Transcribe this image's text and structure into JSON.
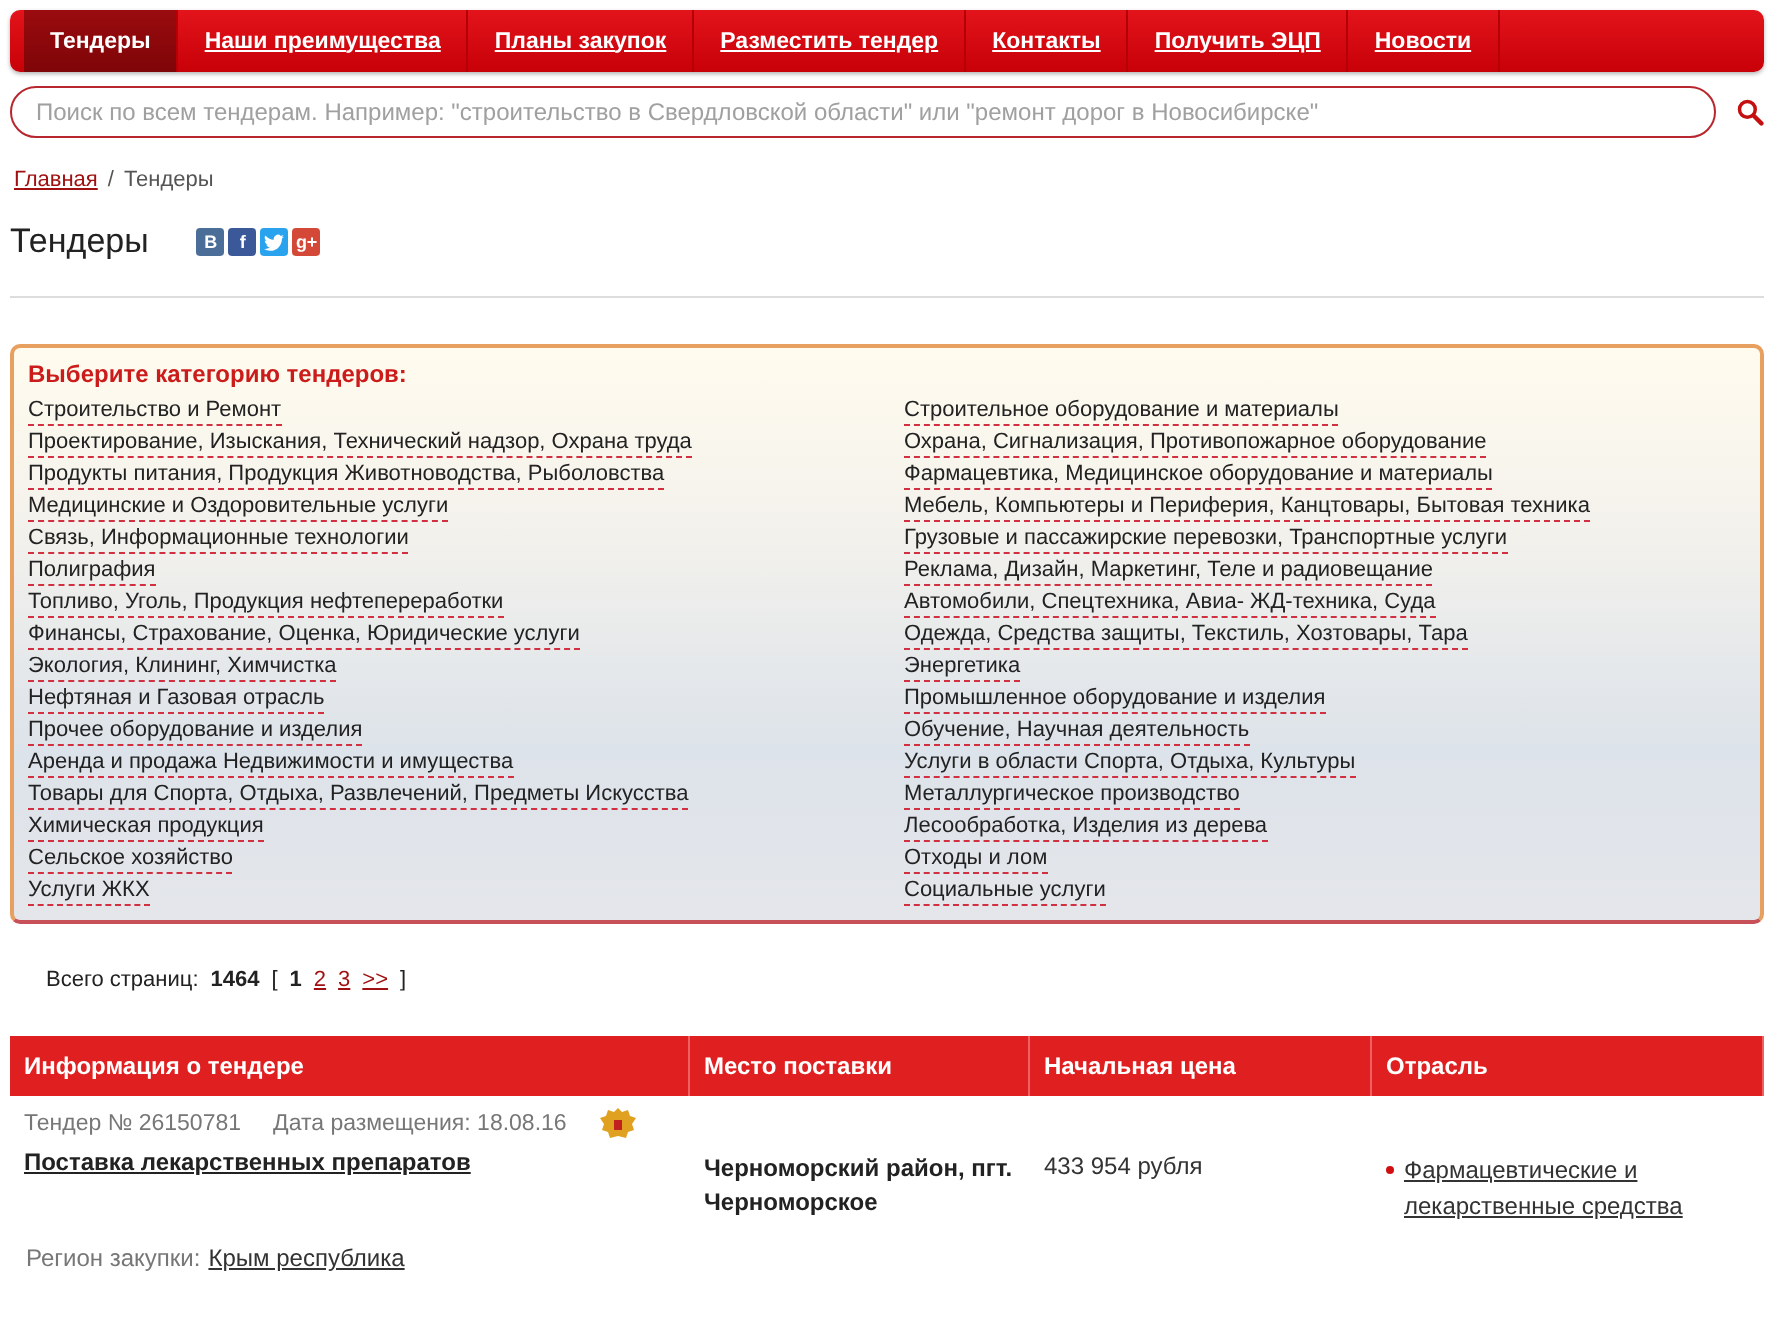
{
  "nav": [
    {
      "label": "Тендеры",
      "selected": true
    },
    {
      "label": "Наши преимущества",
      "selected": false
    },
    {
      "label": "Планы закупок",
      "selected": false
    },
    {
      "label": "Разместить тендер",
      "selected": false
    },
    {
      "label": "Контакты",
      "selected": false
    },
    {
      "label": "Получить ЭЦП",
      "selected": false
    },
    {
      "label": "Новости",
      "selected": false
    }
  ],
  "search": {
    "placeholder": "Поиск по всем тендерам. Например: \"строительство в Свердловской области\" или \"ремонт дорог в Новосибирске\""
  },
  "breadcrumb": {
    "home": "Главная",
    "separator": "/",
    "current": "Тендеры"
  },
  "title": "Тендеры",
  "share": [
    {
      "kind": "vk",
      "label": "В"
    },
    {
      "kind": "facebook",
      "label": "f"
    },
    {
      "kind": "twitter"
    },
    {
      "kind": "gplus",
      "label": "g+"
    }
  ],
  "categories": {
    "heading": "Выберите категорию тендеров:",
    "left": [
      "Строительство и Ремонт",
      "Проектирование, Изыскания, Технический надзор, Охрана труда",
      "Продукты питания, Продукция Животноводства, Рыболовства",
      "Медицинские и Оздоровительные услуги",
      "Связь, Информационные технологии",
      "Полиграфия",
      "Топливо, Уголь, Продукция нефтепереработки",
      "Финансы, Страхование, Оценка, Юридические услуги",
      "Экология, Клининг, Химчистка",
      "Нефтяная и Газовая отрасль",
      "Прочее оборудование и изделия",
      "Аренда и продажа Недвижимости и имущества",
      "Товары для Спорта, Отдыха, Развлечений, Предметы Искусства",
      "Химическая продукция",
      "Сельское хозяйство",
      "Услуги ЖКХ"
    ],
    "right": [
      "Строительное оборудование и материалы",
      "Охрана, Сигнализация, Противопожарное оборудование",
      "Фармацевтика, Медицинское оборудование и материалы",
      "Мебель, Компьютеры и Периферия, Канцтовары, Бытовая техника",
      "Грузовые и пассажирские перевозки, Транспортные услуги",
      "Реклама, Дизайн, Маркетинг, Теле и радиовещание",
      "Автомобили, Спецтехника, Авиа- ЖД-техника, Суда",
      "Одежда, Средства защиты, Текстиль, Хозтовары, Тара",
      "Энергетика",
      "Промышленное оборудование и изделия",
      "Обучение, Научная деятельность",
      "Услуги в области Спорта, Отдыха, Культуры",
      "Металлургическое производство",
      "Лесообработка, Изделия из дерева",
      "Отходы и лом",
      "Социальные услуги"
    ]
  },
  "pagination": {
    "label": "Всего страниц:",
    "total": "1464",
    "open": "[",
    "close": "]",
    "pages": [
      {
        "label": "1",
        "selected": true
      },
      {
        "label": "2",
        "selected": false
      },
      {
        "label": "3",
        "selected": false
      },
      {
        "label": ">>",
        "selected": false
      }
    ]
  },
  "table": {
    "columns": [
      "Информация о тендере",
      "Место поставки",
      "Начальная цена",
      "Отрасль"
    ],
    "rows": [
      {
        "number": "Тендер № 26150781",
        "date": "Дата размещения: 18.08.16",
        "name": "Поставка лекарственных препаратов",
        "place": "Черноморский район, пгт. Черноморское",
        "price": "433 954 рубля",
        "industry": "Фармацевтические и лекарственные средства",
        "region_label": "Регион закупки:",
        "region": "Крым республика"
      }
    ]
  }
}
